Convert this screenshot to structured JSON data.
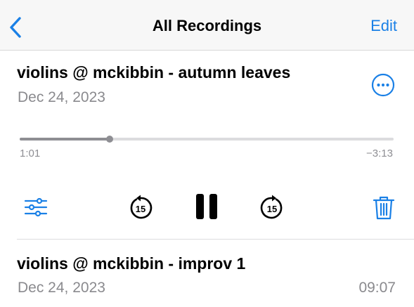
{
  "nav": {
    "title": "All Recordings",
    "edit_label": "Edit",
    "back_icon": "chevron-left-icon"
  },
  "current_recording": {
    "title": "violins @ mckibbin - autumn leaves",
    "date": "Dec 24, 2023",
    "more_icon": "ellipsis-circle-icon",
    "elapsed": "1:01",
    "remaining": "−3:13",
    "progress_fraction": 0.24
  },
  "controls": {
    "options_icon": "sliders-icon",
    "skip_back_icon": "skip-back-15-icon",
    "skip_back_label": "15",
    "pause_icon": "pause-icon",
    "skip_forward_icon": "skip-forward-15-icon",
    "skip_forward_label": "15",
    "delete_icon": "trash-icon"
  },
  "recordings": [
    {
      "title": "violins @ mckibbin - improv 1",
      "date": "Dec 24, 2023",
      "duration": "09:07"
    }
  ],
  "colors": {
    "accent": "#1a80e6",
    "secondary_text": "#8a8a8e",
    "nav_background": "#f7f7f7",
    "scrubber_fill": "#8e8e93",
    "scrubber_track": "#dcdcde"
  }
}
